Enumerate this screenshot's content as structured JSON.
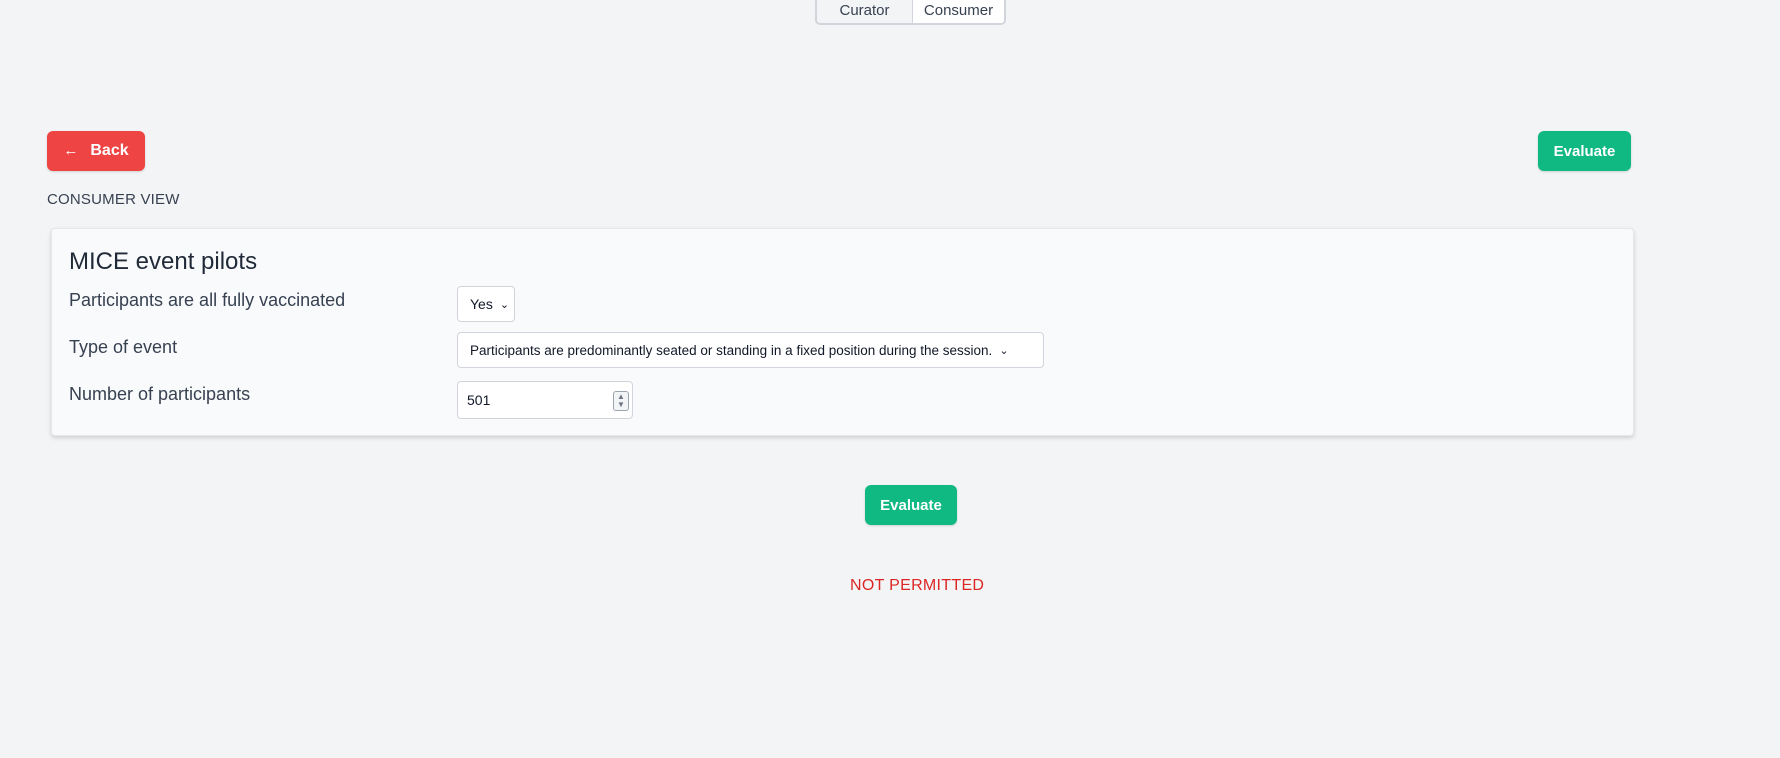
{
  "mode_toggle": {
    "options": [
      "Curator",
      "Consumer"
    ],
    "selected": "Consumer"
  },
  "toolbar": {
    "back_label": "Back",
    "back_icon": "arrow-left-icon",
    "evaluate_label": "Evaluate"
  },
  "view_label": "CONSUMER VIEW",
  "form": {
    "title": "MICE event pilots",
    "fields": [
      {
        "label": "Participants are all fully vaccinated",
        "type": "select",
        "value": "Yes"
      },
      {
        "label": "Type of event",
        "type": "select",
        "value": "Participants are predominantly seated or standing in a fixed position during the session."
      },
      {
        "label": "Number of participants",
        "type": "number",
        "value": "501"
      }
    ]
  },
  "bottom_action": {
    "evaluate_label": "Evaluate"
  },
  "result": {
    "text": "NOT PERMITTED",
    "color": "#dc2626"
  },
  "colors": {
    "background": "#f3f4f6",
    "back_button": "#ef4444",
    "evaluate_button": "#10b981"
  }
}
